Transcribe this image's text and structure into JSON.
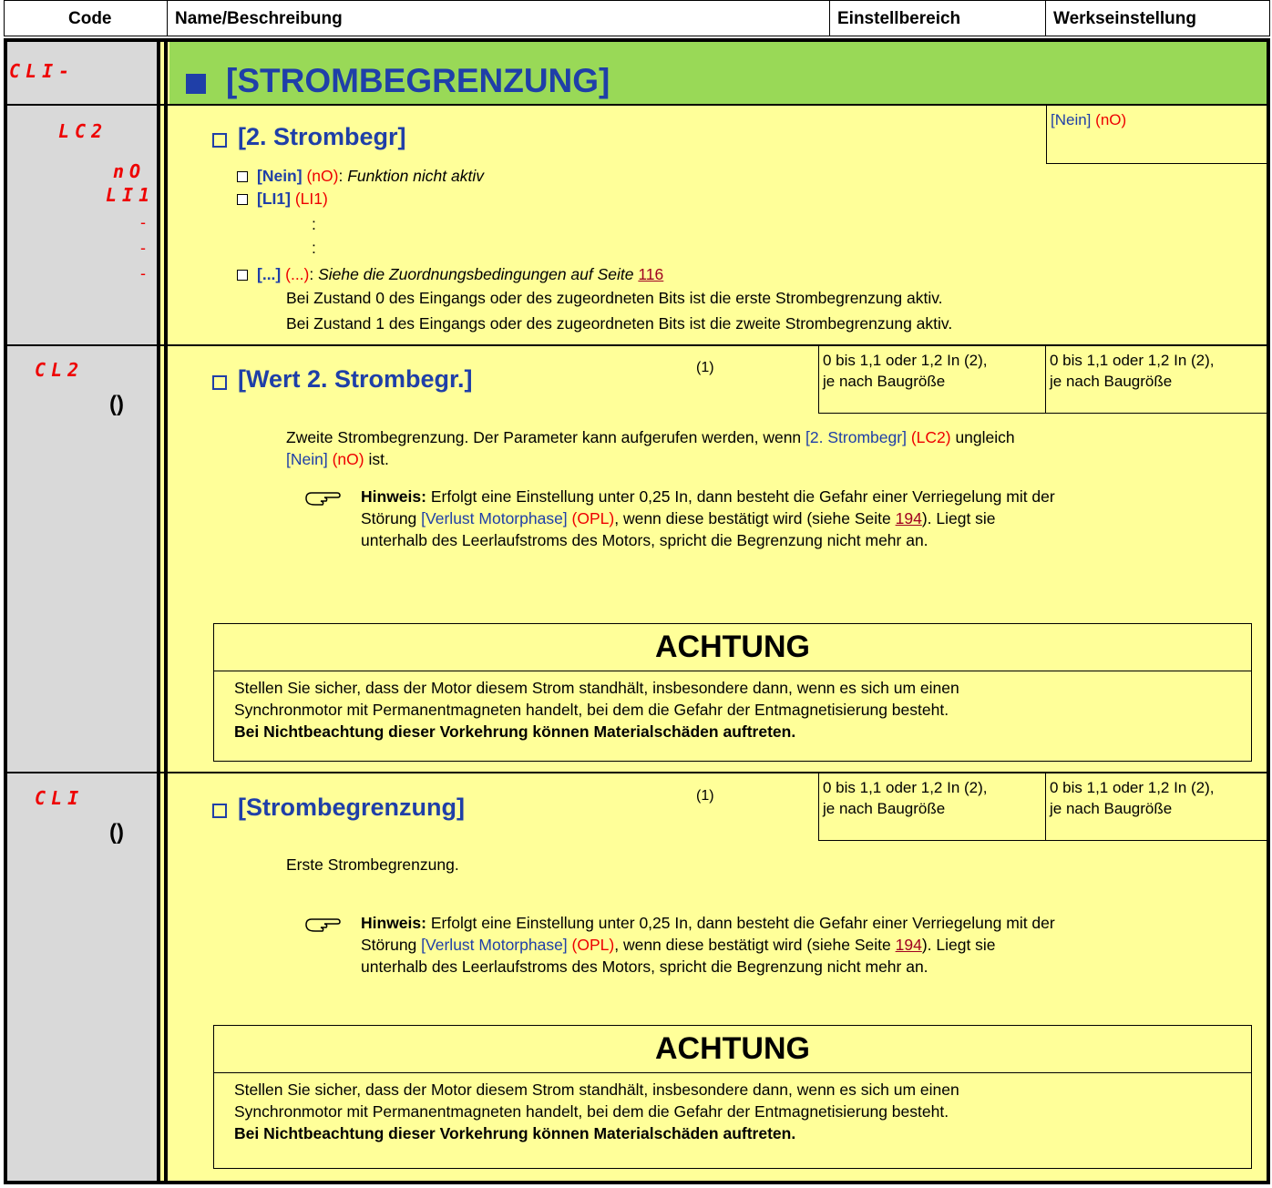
{
  "header": {
    "code": "Code",
    "name": "Name/Beschreibung",
    "range": "Einstellbereich",
    "factory": "Werkseinstellung"
  },
  "menu": {
    "code": "CLI-",
    "title": "[STROMBEGRENZUNG]"
  },
  "lc2": {
    "code": "LC2",
    "title": "[2. Strombegr]",
    "factory": "[Nein]",
    "factory_code": "(nO)",
    "opt_codes": [
      "nO",
      "LI1",
      "-",
      "-",
      "-"
    ],
    "opt1_label": "[Nein]",
    "opt1_code": "(nO)",
    "opt1_desc": "Funktion nicht aktiv",
    "opt2_label": "[LI1]",
    "opt2_code": "(LI1)",
    "dots": ":",
    "opt3_label": "[...]",
    "opt3_code": "(...)",
    "opt3_desc": "Siehe die Zuordnungsbedingungen auf Seite",
    "opt3_page": "116",
    "line1": "Bei Zustand 0 des Eingangs oder des zugeordneten Bits ist die erste Strombegrenzung aktiv.",
    "line2": "Bei Zustand 1 des Eingangs oder des zugeordneten Bits ist die zweite Strombegrenzung aktiv."
  },
  "cl2": {
    "code": "CL2",
    "title": "[Wert 2. Strombegr.]",
    "note": "(1)",
    "range_l1": "0 bis 1,1 oder 1,2 In (2),",
    "range_l2": "je nach Baugröße",
    "factory_l1": "0 bis 1,1 oder 1,2 In (2),",
    "factory_l2": "je nach Baugröße",
    "desc_a": "Zweite Strombegrenzung. Der Parameter kann aufgerufen werden, wenn",
    "desc_ref": "[2. Strombegr]",
    "desc_ref_code": "(LC2)",
    "desc_b": "ungleich",
    "desc_ref2": "[Nein]",
    "desc_ref2_code": "(nO)",
    "desc_c": "ist.",
    "hint_label": "Hinweis:",
    "hint_a": "Erfolgt eine Einstellung unter 0,25 In, dann besteht die Gefahr einer Verriegelung mit der",
    "hint_b1": "Störung",
    "hint_ref": "[Verlust Motorphase]",
    "hint_ref_code": "(OPL)",
    "hint_b2": ", wenn diese bestätigt wird (siehe Seite",
    "hint_page": "194",
    "hint_b3": "). Liegt sie",
    "hint_c": "unterhalb des Leerlaufstroms des Motors, spricht die Begrenzung nicht mehr an."
  },
  "warning": {
    "title": "ACHTUNG",
    "l1": "Stellen Sie sicher, dass der Motor diesem Strom standhält, insbesondere dann, wenn es sich um einen",
    "l2": "Synchronmotor mit Permanentmagneten handelt, bei dem die Gefahr der Entmagnetisierung besteht.",
    "l3": "Bei Nichtbeachtung dieser Vorkehrung können Materialschäden auftreten."
  },
  "cl1": {
    "code": "CLI",
    "title": "[Strombegrenzung]",
    "note": "(1)",
    "range_l1": "0 bis 1,1 oder 1,2 In (2),",
    "range_l2": "je nach Baugröße",
    "factory_l1": "0 bis 1,1 oder 1,2 In (2),",
    "factory_l2": "je nach Baugröße",
    "desc": "Erste Strombegrenzung."
  },
  "icons": {
    "param_change": "parentheses-icon",
    "hint": "pointing-hand-icon"
  },
  "colors": {
    "blue": "#1f3fa8",
    "red": "#e00000",
    "yellow": "#ffff99",
    "green": "#99d957",
    "grey": "#d9d9d9"
  }
}
